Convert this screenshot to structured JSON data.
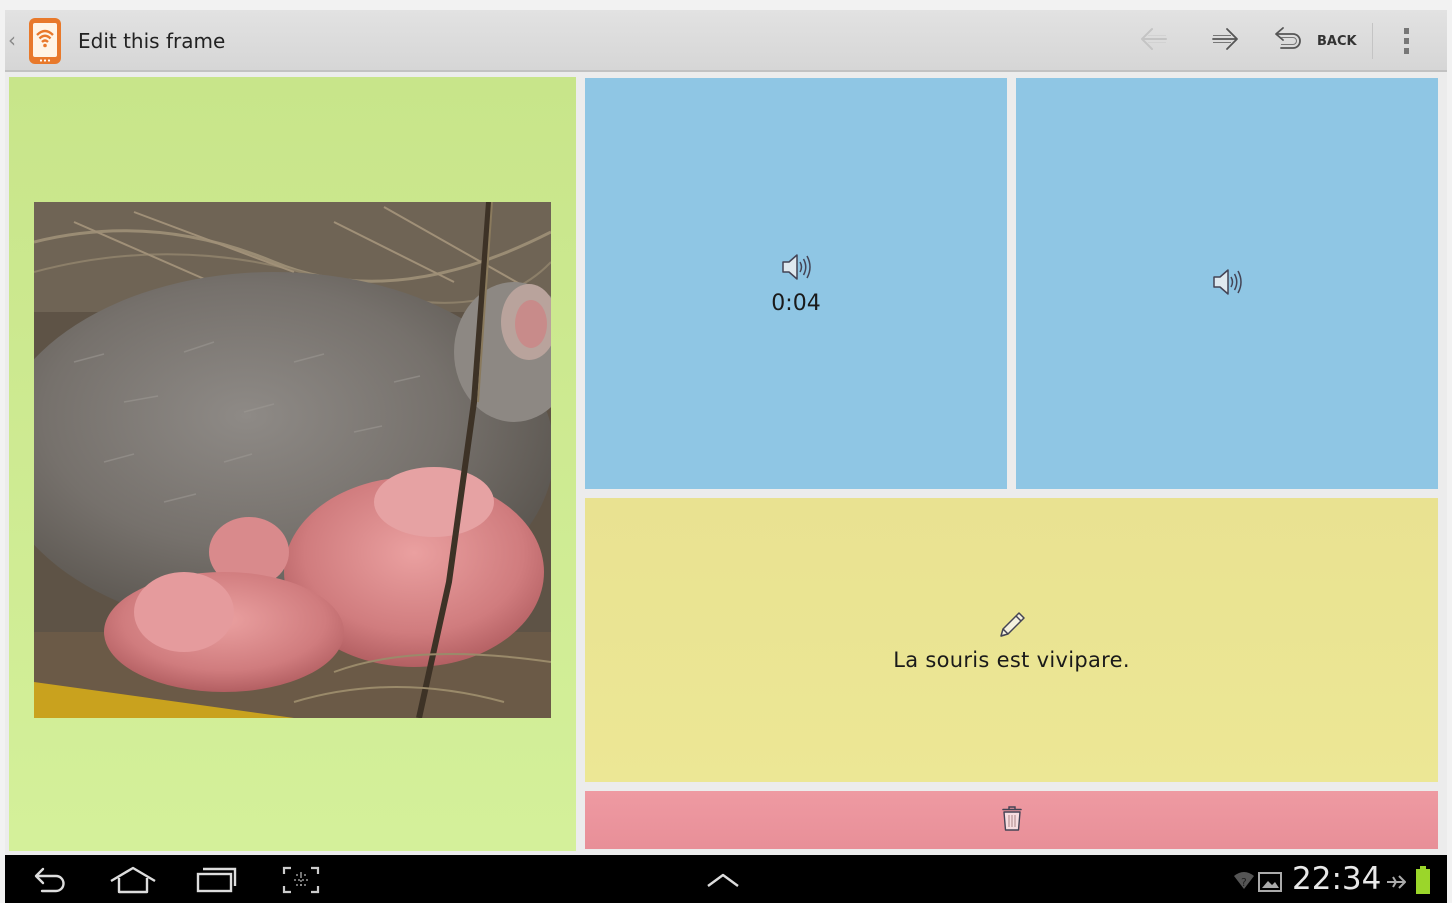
{
  "action_bar": {
    "title": "Edit this frame",
    "back_label": "BACK",
    "icons": [
      "up-caret-icon",
      "app-wifi-phone-icon",
      "undo-arrow-icon",
      "redo-arrow-icon",
      "back-return-icon",
      "overflow-menu-icon"
    ]
  },
  "panels": {
    "image": {
      "icon": "mouse-photo",
      "color": "#c8e58a"
    },
    "audio_recorded": {
      "icon": "speaker-icon",
      "duration": "0:04",
      "color": "#8fc6e4"
    },
    "audio_empty": {
      "icon": "speaker-icon",
      "color": "#8fc6e4"
    },
    "text": {
      "icon": "pencil-icon",
      "caption": "La souris est vivipare.",
      "color": "#e9e291"
    },
    "delete": {
      "icon": "trash-icon",
      "color": "#ee9aa2"
    }
  },
  "system_bar": {
    "time": "22:34",
    "icons": [
      "nav-back-icon",
      "nav-home-icon",
      "nav-recent-icon",
      "screenshot-icon",
      "nav-up-chevron-icon",
      "wifi-icon",
      "gallery-icon",
      "airplane-icon",
      "battery-icon"
    ]
  }
}
